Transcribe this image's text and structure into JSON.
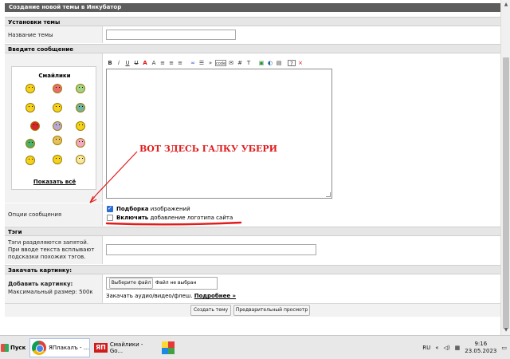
{
  "header": {
    "title": "Создание новой темы в Инкубатор"
  },
  "sections": {
    "settings": "Установки темы",
    "message": "Введите сообщение",
    "tags": "Тэги",
    "upload": "Закачать картинку:"
  },
  "topic": {
    "name_label": "Название темы",
    "name_value": ""
  },
  "smilies": {
    "title": "Смайлики",
    "show_all": "Показать всё",
    "count": 15
  },
  "toolbar": {
    "buttons": [
      "B",
      "i",
      "U",
      "U",
      "A",
      "A",
      "≡",
      "≡",
      "≡",
      "∞",
      "☰",
      "»",
      "code",
      "✉",
      "#",
      "T",
      "▣",
      "◐",
      "▤",
      "?",
      "×"
    ]
  },
  "options": {
    "label": "Опции сообщения",
    "opt1_bold": "Подборка",
    "opt1_text": "изображений",
    "opt1_checked": true,
    "opt2_bold": "Включить",
    "opt2_text": "добавление логотипа сайта",
    "opt2_checked": false
  },
  "annotation": {
    "text": "ВОТ ЗДЕСЬ ГАЛКУ УБЕРИ",
    "color": "#e21b1b"
  },
  "tags": {
    "hint": "Тэги разделяются запятой. При вводе текста всплывают подсказки похожих тэгов.",
    "value": ""
  },
  "upload": {
    "label": "Добавить картинку:",
    "max_size": "Максимальный размер: 500к",
    "choose_button": "Выберите файл",
    "no_file": "Файл не выбран",
    "audio_text": "Закачать аудио/видео/флеш.",
    "more_link": "Подробнее »"
  },
  "buttons": {
    "create": "Создать тему",
    "preview": "Предварительный просмотр"
  },
  "taskbar": {
    "start": "Пуск",
    "item1": "ЯПлакалъ - ...",
    "item2": "Смайлики - Go...",
    "lang": "RU",
    "time": "9:16",
    "date": "23.05.2023"
  }
}
